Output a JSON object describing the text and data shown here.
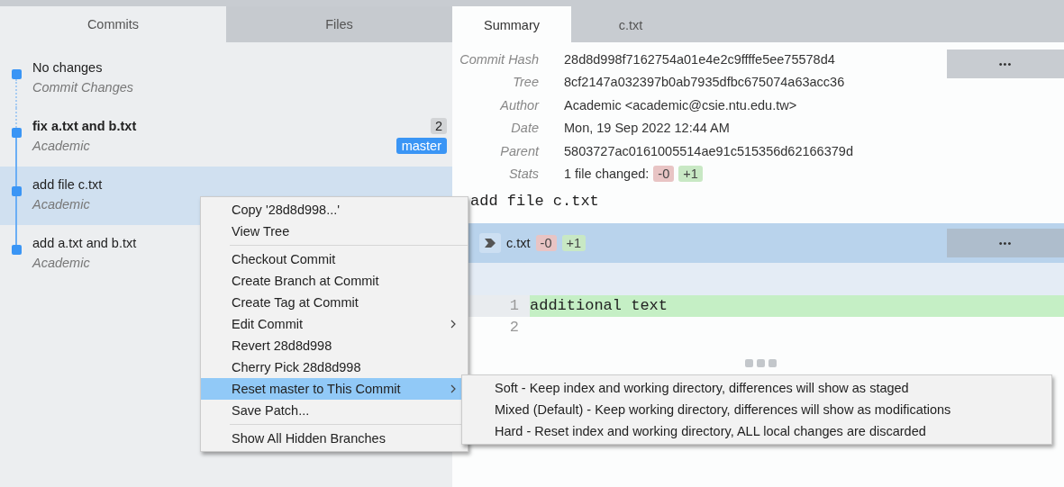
{
  "left_tabs": [
    {
      "label": "Commits",
      "selected": true
    },
    {
      "label": "Files",
      "selected": false
    }
  ],
  "commits": [
    {
      "kind": "uncommitted",
      "title": "No changes",
      "subtitle": "Commit Changes",
      "selected": false
    },
    {
      "kind": "head",
      "title": "fix a.txt and b.txt",
      "subtitle": "Academic",
      "count": "2",
      "branch": "master",
      "selected": false
    },
    {
      "kind": "commit",
      "title": "add file c.txt",
      "subtitle": "Academic",
      "selected": true
    },
    {
      "kind": "commit",
      "title": "add a.txt and b.txt",
      "subtitle": "Academic",
      "selected": false
    }
  ],
  "right_tabs": [
    {
      "label": "Summary",
      "selected": true
    },
    {
      "label": "c.txt",
      "selected": false
    }
  ],
  "summary": {
    "fields": [
      {
        "label": "Commit Hash",
        "value": "28d8d998f7162754a01e4e2c9ffffe5ee75578d4"
      },
      {
        "label": "Tree",
        "value": "8cf2147a032397b0ab7935dfbc675074a63acc36"
      },
      {
        "label": "Author",
        "value": "Academic <academic@csie.ntu.edu.tw>"
      },
      {
        "label": "Date",
        "value": "Mon, 19 Sep 2022 12:44 AM"
      },
      {
        "label": "Parent",
        "value": "5803727ac0161005514ae91c515356d62166379d"
      }
    ],
    "stats": {
      "label": "Stats",
      "text": "1 file changed:",
      "removed": "-0",
      "added": "+1"
    },
    "more_button": "•••",
    "message": "add file c.txt"
  },
  "file": {
    "name": "c.txt",
    "removed": "-0",
    "added": "+1",
    "more_button": "•••",
    "lines": [
      {
        "number": "1",
        "text": "additional text",
        "kind": "added"
      },
      {
        "number": "2",
        "kind": "context"
      }
    ]
  },
  "context_menu": {
    "groups": [
      [
        {
          "label": "Copy '28d8d998...'",
          "submenu": false,
          "selected": false
        },
        {
          "label": "View Tree",
          "submenu": false,
          "selected": false
        }
      ],
      [
        {
          "label": "Checkout Commit",
          "submenu": false,
          "selected": false
        },
        {
          "label": "Create Branch at Commit",
          "submenu": false,
          "selected": false
        },
        {
          "label": "Create Tag at Commit",
          "submenu": false,
          "selected": false
        },
        {
          "label": "Edit Commit",
          "submenu": true,
          "selected": false
        },
        {
          "label": "Revert 28d8d998",
          "submenu": false,
          "selected": false
        },
        {
          "label": "Cherry Pick 28d8d998",
          "submenu": false,
          "selected": false
        },
        {
          "label": "Reset master to This Commit",
          "submenu": true,
          "selected": true
        },
        {
          "label": "Save Patch...",
          "submenu": false,
          "selected": false
        }
      ],
      [
        {
          "label": "Show All Hidden Branches",
          "submenu": false,
          "selected": false
        }
      ]
    ]
  },
  "submenu": {
    "items": [
      "Soft - Keep index and working directory, differences will show as staged",
      "Mixed (Default) - Keep working directory, differences will show as modifications",
      "Hard - Reset index and working directory, ALL local changes are discarded"
    ]
  }
}
